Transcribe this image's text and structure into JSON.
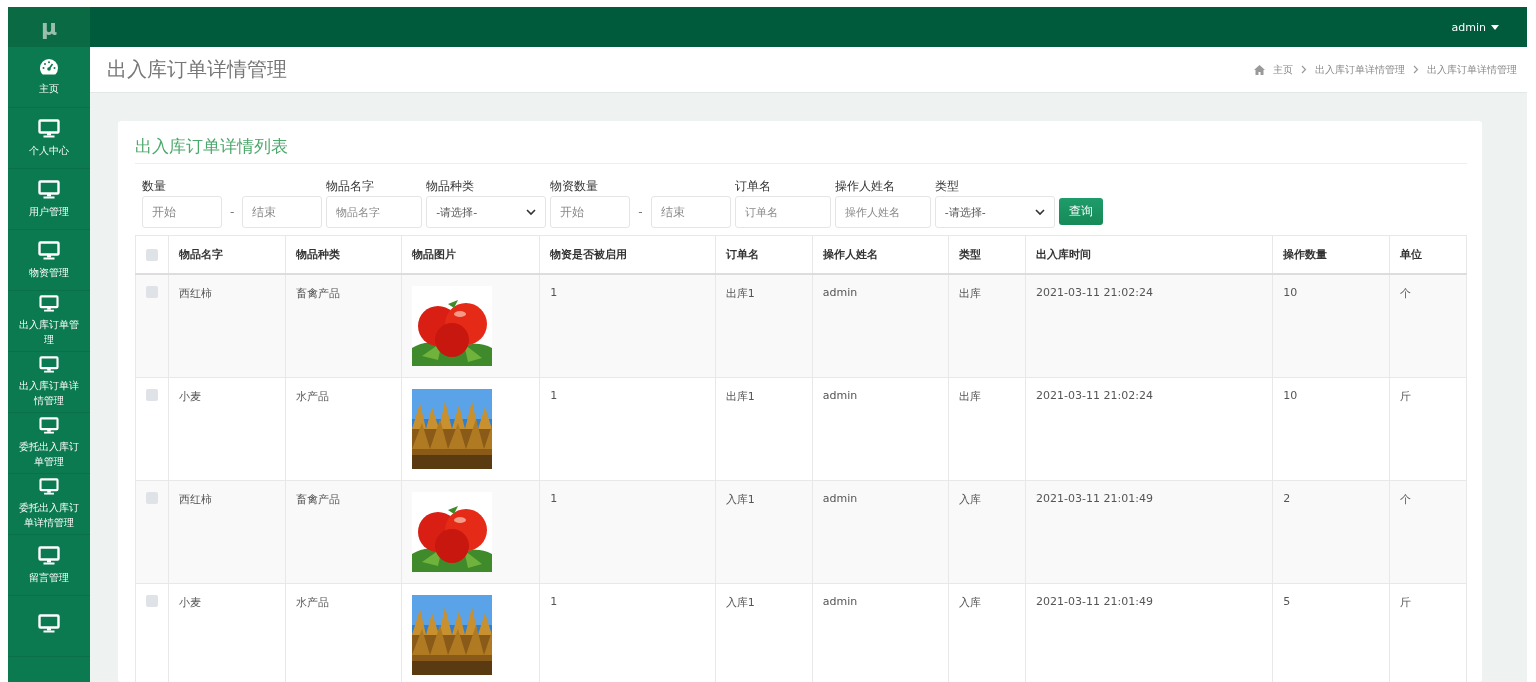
{
  "logo": "μ",
  "user_menu": {
    "label": "admin"
  },
  "sidebar": {
    "items": [
      {
        "kind": "dashboard",
        "label": "主页"
      },
      {
        "kind": "monitor",
        "label": "个人中心"
      },
      {
        "kind": "monitor",
        "label": "用户管理"
      },
      {
        "kind": "monitor",
        "label": "物资管理"
      },
      {
        "kind": "monitor",
        "label": "出入库订单管理"
      },
      {
        "kind": "monitor",
        "label": "出入库订单详情管理"
      },
      {
        "kind": "monitor",
        "label": "委托出入库订单管理"
      },
      {
        "kind": "monitor",
        "label": "委托出入库订单详情管理"
      },
      {
        "kind": "monitor",
        "label": "留言管理"
      },
      {
        "kind": "monitor"
      }
    ]
  },
  "page_title": "出入库订单详情管理",
  "breadcrumb": [
    "主页",
    "出入库订单详情管理",
    "出入库订单详情管理"
  ],
  "card_title": "出入库订单详情列表",
  "filters": [
    {
      "kind": "range",
      "label": "数量",
      "placeholder_from": "开始",
      "separator": "-",
      "placeholder_to": "结束"
    },
    {
      "kind": "text",
      "label": "物品名字",
      "placeholder": "物品名字"
    },
    {
      "kind": "select",
      "label": "物品种类",
      "value": "-请选择-"
    },
    {
      "kind": "range",
      "label": "物资数量",
      "placeholder_from": "开始",
      "separator": "-",
      "placeholder_to": "结束"
    },
    {
      "kind": "text",
      "label": "订单名",
      "placeholder": "订单名"
    },
    {
      "kind": "text",
      "label": "操作人姓名",
      "placeholder": "操作人姓名"
    },
    {
      "kind": "select",
      "label": "类型",
      "value": "-请选择-"
    }
  ],
  "search_button": "查询",
  "table": {
    "select_all_checked": false,
    "columns": [
      "物品名字",
      "物品种类",
      "物品图片",
      "物资是否被启用",
      "订单名",
      "操作人姓名",
      "类型",
      "出入库时间",
      "操作数量",
      "单位"
    ],
    "rows": [
      {
        "checked": false,
        "cells": [
          "西红柿",
          "畜禽产品",
          null,
          "1",
          "出库1",
          "admin",
          "出库",
          "2021-03-11 21:02:24",
          "10",
          "个"
        ]
      },
      {
        "checked": false,
        "cells": [
          "小麦",
          "水产品",
          null,
          "1",
          "出库1",
          "admin",
          "出库",
          "2021-03-11 21:02:24",
          "10",
          "斤"
        ]
      },
      {
        "checked": false,
        "cells": [
          "西红柿",
          "畜禽产品",
          null,
          "1",
          "入库1",
          "admin",
          "入库",
          "2021-03-11 21:01:49",
          "2",
          "个"
        ]
      },
      {
        "checked": false,
        "cells": [
          "小麦",
          "水产品",
          null,
          "1",
          "入库1",
          "admin",
          "入库",
          "2021-03-11 21:01:49",
          "5",
          "斤"
        ]
      }
    ]
  }
}
